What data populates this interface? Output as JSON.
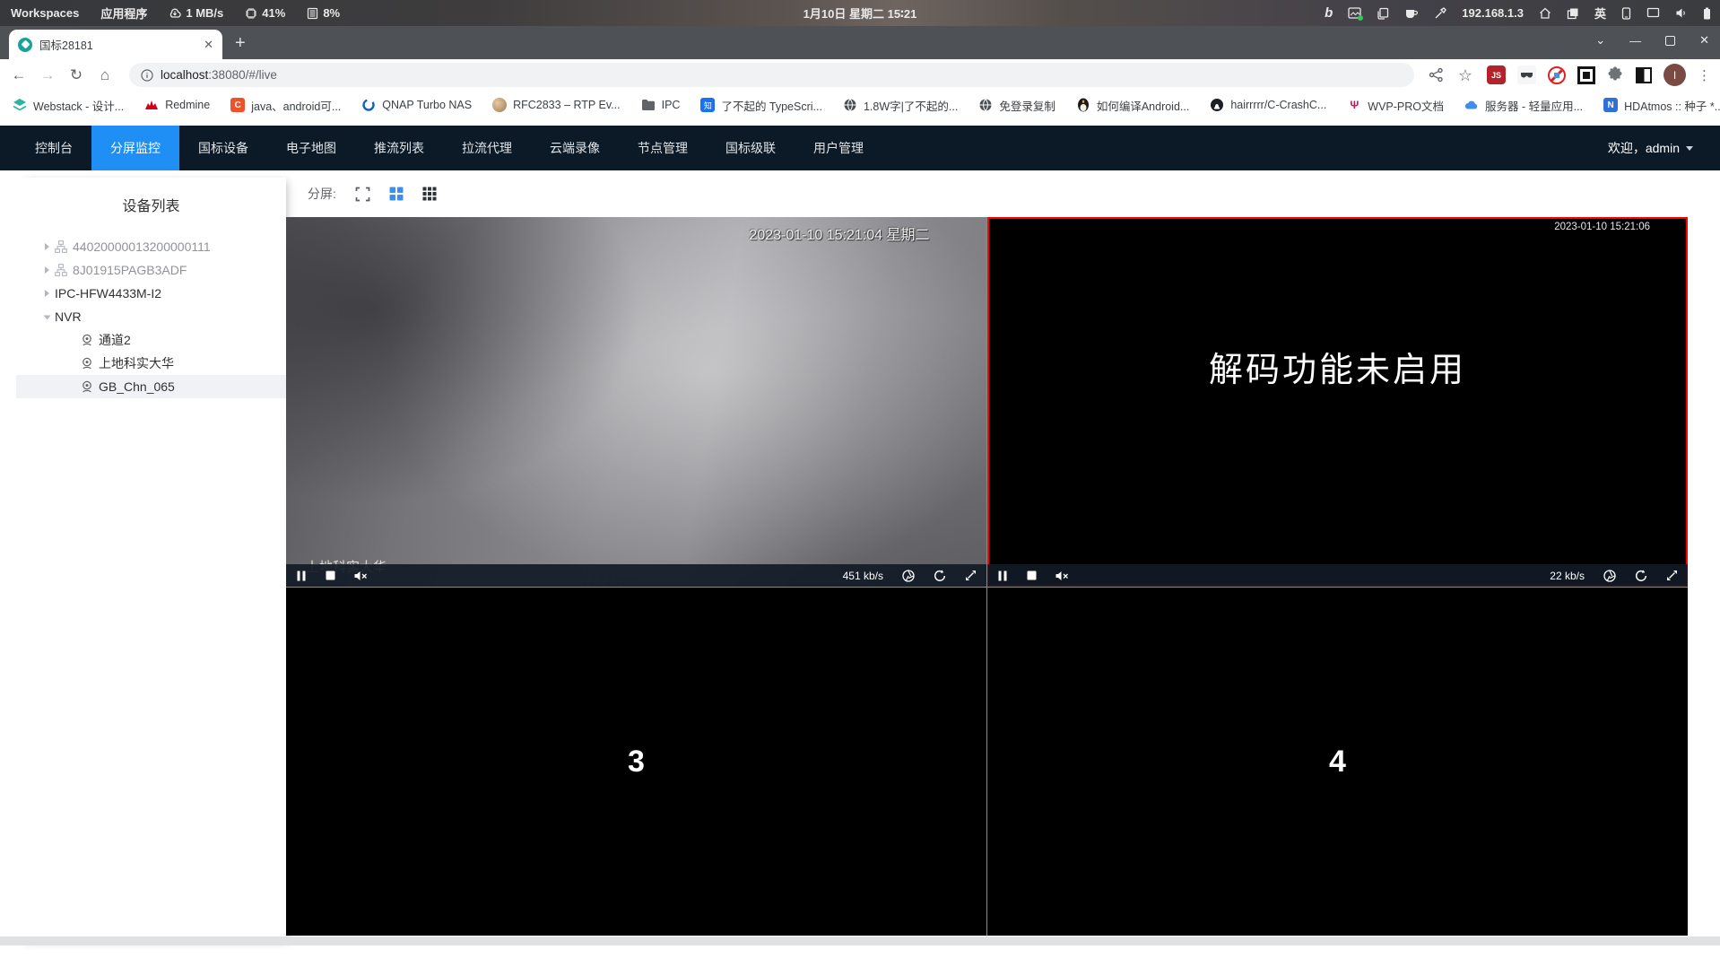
{
  "os_bar": {
    "workspaces": "Workspaces",
    "applications": "应用程序",
    "net_speed": "1 MB/s",
    "cpu": "41%",
    "mem": "8%",
    "clock": "1月10日 星期二 15∶21",
    "ip": "192.168.1.3",
    "lang": "英"
  },
  "browser": {
    "tab_title": "国标28181",
    "tab_close": "✕",
    "new_tab": "+",
    "url_host": "localhost",
    "url_rest": ":38080/#/live",
    "win_min": "—",
    "win_close": "✕",
    "tab_search": "⌄",
    "star": "☆",
    "js_badge": "JS",
    "avatar_letter": "I",
    "kebab": "⋮",
    "back": "←",
    "forward": "→",
    "reload": "↻",
    "home": "⌂",
    "bookmarks": [
      {
        "icon": "webstack-icon",
        "label": "Webstack - 设计..."
      },
      {
        "icon": "redmine-icon",
        "label": "Redmine"
      },
      {
        "icon": "c-icon",
        "label": "java、android可..."
      },
      {
        "icon": "qnap-icon",
        "label": "QNAP Turbo NAS"
      },
      {
        "icon": "avatar-photo-icon",
        "label": "RFC2833 – RTP Ev..."
      },
      {
        "icon": "folder-icon",
        "label": "IPC"
      },
      {
        "icon": "zhihu-icon",
        "label": "了不起的 TypeScri..."
      },
      {
        "icon": "globe-icon",
        "label": "1.8W字|了不起的..."
      },
      {
        "icon": "globe-icon",
        "label": "免登录复制"
      },
      {
        "icon": "penguin-icon",
        "label": "如何编译Android..."
      },
      {
        "icon": "github-icon",
        "label": "hairrrrr/C-CrashC..."
      },
      {
        "icon": "wvp-icon",
        "label": "WVP-PRO文档"
      },
      {
        "icon": "cloud-icon",
        "label": "服务器 - 轻量应用..."
      },
      {
        "icon": "nas-icon",
        "label": "HDAtmos :: 种子 *..."
      }
    ],
    "bookmarks_overflow": "»"
  },
  "app": {
    "nav": [
      {
        "label": "控制台"
      },
      {
        "label": "分屏监控",
        "active": true
      },
      {
        "label": "国标设备"
      },
      {
        "label": "电子地图"
      },
      {
        "label": "推流列表"
      },
      {
        "label": "拉流代理"
      },
      {
        "label": "云端录像"
      },
      {
        "label": "节点管理"
      },
      {
        "label": "国标级联"
      },
      {
        "label": "用户管理"
      }
    ],
    "welcome": "欢迎，admin",
    "sidebar": {
      "title": "设备列表",
      "tree": [
        {
          "label": "44020000013200000111",
          "type": "platform",
          "state": "offline"
        },
        {
          "label": "8J01915PAGB3ADF",
          "type": "platform",
          "state": "offline"
        },
        {
          "label": "IPC-HFW4433M-I2",
          "type": "device",
          "state": "online"
        },
        {
          "label": "NVR",
          "type": "device",
          "expanded": true
        },
        {
          "label": "通道2",
          "type": "channel"
        },
        {
          "label": "上地科实大华",
          "type": "channel"
        },
        {
          "label": "GB_Chn_065",
          "type": "channel",
          "selected": true
        }
      ]
    },
    "split": {
      "label": "分屏:"
    },
    "videos": {
      "v1": {
        "timestamp": "2023-01-10 15:21:04 星期二",
        "name": "上地科实大华",
        "bitrate": "451 kb/s"
      },
      "v2": {
        "timestamp": "2023-01-10 15:21:06",
        "message": "解码功能未启用",
        "bitrate": "22 kb/s",
        "selected": true
      },
      "v3": {
        "num": "3"
      },
      "v4": {
        "num": "4"
      }
    },
    "colors": {
      "navbar_bg": "#0c1a28",
      "accent_blue": "#1f8ef5",
      "active_border_red": "#ff0000",
      "favicon_teal": "#17a398"
    }
  }
}
